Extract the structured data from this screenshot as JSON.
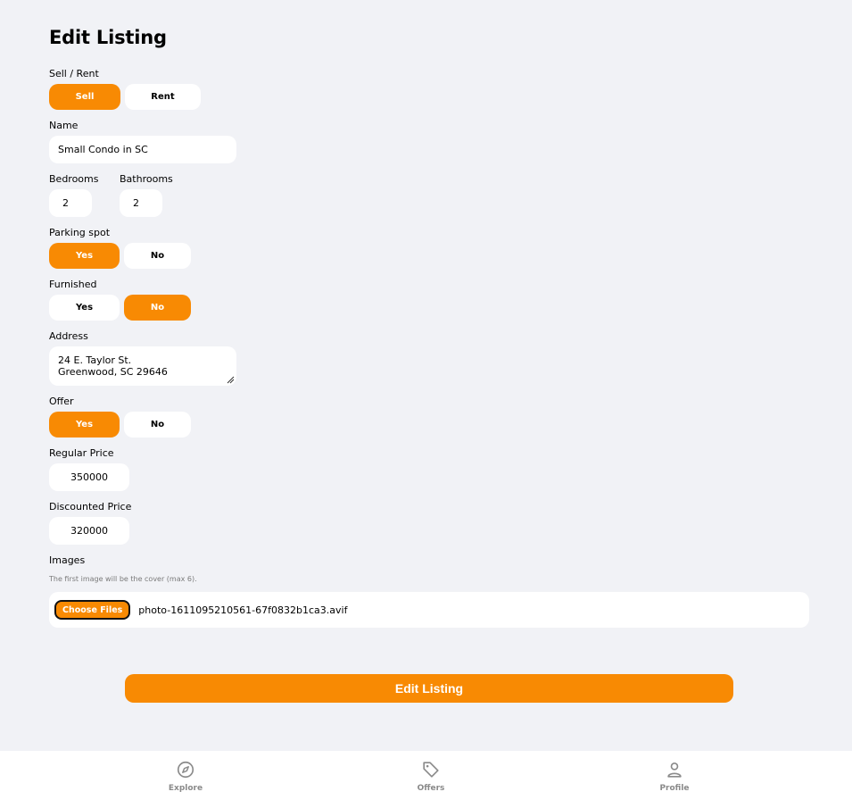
{
  "title": "Edit Listing",
  "type_field": {
    "label": "Sell / Rent",
    "options": [
      "Sell",
      "Rent"
    ],
    "selected": "Sell"
  },
  "name_field": {
    "label": "Name",
    "value": "Small Condo in SC"
  },
  "bedrooms_field": {
    "label": "Bedrooms",
    "value": "2"
  },
  "bathrooms_field": {
    "label": "Bathrooms",
    "value": "2"
  },
  "parking_field": {
    "label": "Parking spot",
    "options": [
      "Yes",
      "No"
    ],
    "selected": "Yes"
  },
  "furnished_field": {
    "label": "Furnished",
    "options": [
      "Yes",
      "No"
    ],
    "selected": "No"
  },
  "address_field": {
    "label": "Address",
    "lines": [
      "24 E. Taylor St.",
      "Greenwood, SC 29646"
    ]
  },
  "offer_field": {
    "label": "Offer",
    "options": [
      "Yes",
      "No"
    ],
    "selected": "Yes"
  },
  "regular_price_field": {
    "label": "Regular Price",
    "value": "350000"
  },
  "discounted_price_field": {
    "label": "Discounted Price",
    "value": "320000"
  },
  "images_field": {
    "label": "Images",
    "hint": "The first image will be the cover (max 6).",
    "button_label": "Choose Files",
    "file_name": "photo-1611095210561-67f0832b1ca3.avif"
  },
  "submit_label": "Edit Listing",
  "navbar": {
    "items": [
      {
        "label": "Explore",
        "icon": "compass-icon"
      },
      {
        "label": "Offers",
        "icon": "tag-icon"
      },
      {
        "label": "Profile",
        "icon": "person-icon"
      }
    ]
  },
  "colors": {
    "accent": "#f88a03",
    "background": "#f1f2f6",
    "nav_inactive": "#8a8a8a"
  }
}
